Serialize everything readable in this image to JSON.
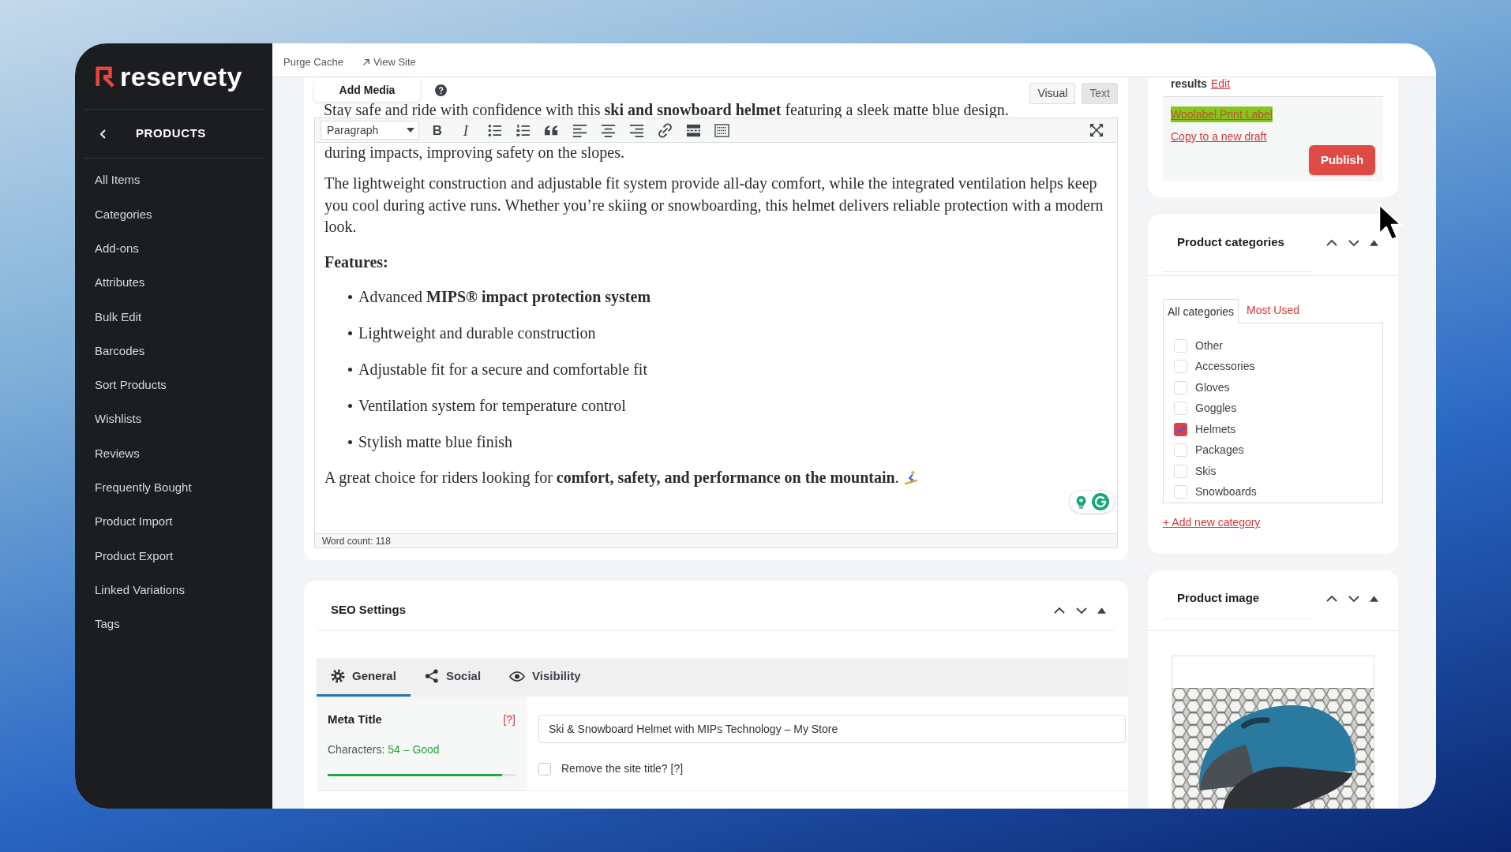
{
  "sidebar": {
    "logo_text": "reservety",
    "section_title": "PRODUCTS",
    "items": [
      {
        "label": "All Items",
        "selected": false
      },
      {
        "label": "Categories",
        "selected": false
      },
      {
        "label": "Add-ons",
        "selected": false
      },
      {
        "label": "Attributes",
        "selected": false
      },
      {
        "label": "Bulk Edit",
        "selected": false
      },
      {
        "label": "Barcodes",
        "selected": false
      },
      {
        "label": "Sort Products",
        "selected": false
      },
      {
        "label": "Wishlists",
        "selected": false
      },
      {
        "label": "Reviews",
        "selected": false
      },
      {
        "label": "Frequently Bought",
        "selected": false
      },
      {
        "label": "Product Import",
        "selected": false
      },
      {
        "label": "Product Export",
        "selected": false
      },
      {
        "label": "Linked Variations",
        "selected": false
      },
      {
        "label": "Tags",
        "selected": false
      }
    ]
  },
  "top_bar": {
    "links": [
      {
        "kind": "plain",
        "label": "Purge Cache"
      },
      {
        "kind": "external",
        "label": "View Site"
      }
    ]
  },
  "editor": {
    "add_media": "Add Media",
    "mode_tabs": [
      {
        "label": "Visual",
        "selected": true
      },
      {
        "label": "Text",
        "selected": false
      }
    ],
    "format_select": "Paragraph",
    "format_buttons": [
      {
        "kind": "bold",
        "label": "B"
      },
      {
        "kind": "italic",
        "label": "I"
      }
    ],
    "top_line": "Stay safe and ride with confidence with this **ski and snowboard helmet** featuring a sleek matte blue design.",
    "content": [
      {
        "kind": "paragraph",
        "text": "during impacts, improving safety on the slopes."
      },
      {
        "kind": "paragraph",
        "text": "The lightweight construction and adjustable fit system provide all-day comfort, while the integrated ventilation helps keep you cool during active runs. Whether you’re skiing or snowboarding, this helmet delivers reliable protection with a modern look."
      },
      {
        "kind": "heading",
        "text": "Features:"
      },
      {
        "kind": "list",
        "items": [
          "Advanced **MIPS® impact protection system**",
          "Lightweight and durable construction",
          "Adjustable fit for a secure and comfortable fit",
          "Ventilation system for temperature control",
          "Stylish matte blue finish"
        ]
      },
      {
        "kind": "paragraph",
        "text": "A great choice for riders looking for **comfort, safety, and performance on the mountain**.",
        "has_emoji": true
      }
    ],
    "word_count": "Word count: 118"
  },
  "seo_settings": {
    "title": "SEO Settings",
    "tabs": [
      {
        "label": "General",
        "selected": true
      },
      {
        "label": "Social",
        "selected": false
      },
      {
        "label": "Visibility",
        "selected": false
      }
    ],
    "meta_title": {
      "label": "Meta Title",
      "help": "[?]",
      "characters_label": "Characters:",
      "characters_value": "54 – Good",
      "level": 0.93,
      "value": "Ski & Snowboard Helmet with MIPs Technology – My Store",
      "remove_site_title": {
        "label": "Remove the site title? [?]",
        "checked": false
      }
    }
  },
  "publish_box": {
    "results_label": "results",
    "edit_link": "Edit",
    "links": [
      {
        "kind": "highlighted",
        "label": "Woolabel Print Label"
      },
      {
        "kind": "plain",
        "label": "Copy to a new draft"
      }
    ],
    "publish_button": "Publish"
  },
  "product_categories": {
    "title": "Product categories",
    "tabs": [
      {
        "label": "All categories",
        "selected": true
      },
      {
        "label": "Most Used",
        "selected": false
      }
    ],
    "items": [
      {
        "label": "Other",
        "checked": false
      },
      {
        "label": "Accessories",
        "checked": false
      },
      {
        "label": "Gloves",
        "checked": false
      },
      {
        "label": "Goggles",
        "checked": false
      },
      {
        "label": "Helmets",
        "checked": true
      },
      {
        "label": "Packages",
        "checked": false
      },
      {
        "label": "Skis",
        "checked": false
      },
      {
        "label": "Snowboards",
        "checked": false
      }
    ],
    "add_link": "+ Add new category"
  },
  "product_image": {
    "title": "Product image"
  }
}
